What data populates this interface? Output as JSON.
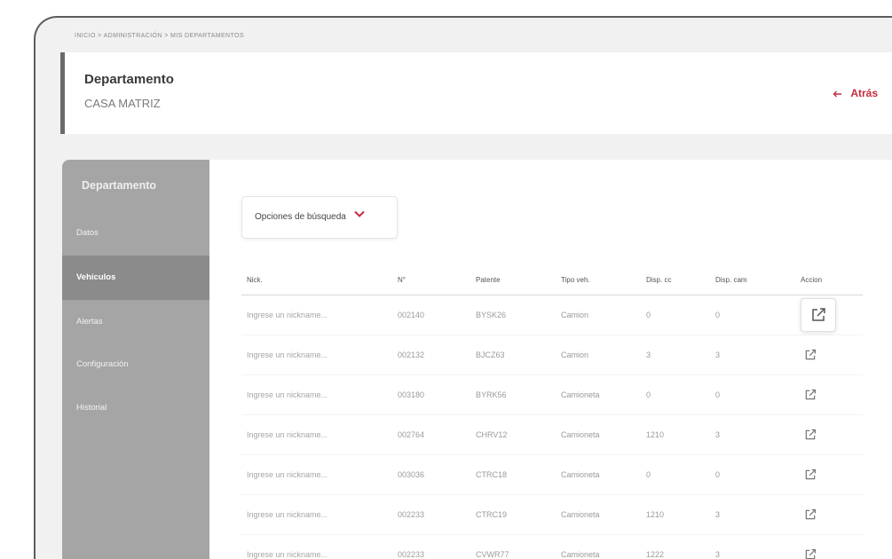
{
  "breadcrumb": "INICIO > ADMINISTRACIÓN > MIS DEPARTAMENTOS",
  "header": {
    "label": "Departamento",
    "name": "CASA MATRIZ",
    "back_label": "Atrás"
  },
  "sidebar": {
    "title": "Departamento",
    "items": [
      {
        "label": "Datos",
        "active": false
      },
      {
        "label": "Vehículos",
        "active": true
      },
      {
        "label": "Alertas",
        "active": false
      },
      {
        "label": "Configuración",
        "active": false
      },
      {
        "label": "Historial",
        "active": false
      }
    ]
  },
  "search": {
    "label": "Opciones de búsqueda"
  },
  "table": {
    "headers": [
      "Nick.",
      "N°",
      "Patente",
      "Tipo veh.",
      "Disp. cc",
      "Disp. cam",
      "Accion"
    ],
    "rows": [
      {
        "nick_placeholder": "Ingrese un nickname...",
        "num": "002140",
        "plate": "BYSK26",
        "type": "Camion",
        "disp_cc": "0",
        "disp_cam": "0"
      },
      {
        "nick_placeholder": "Ingrese un nickname...",
        "num": "002132",
        "plate": "BJCZ63",
        "type": "Camion",
        "disp_cc": "3",
        "disp_cam": "3"
      },
      {
        "nick_placeholder": "Ingrese un nickname...",
        "num": "003180",
        "plate": "BYRK56",
        "type": "Camioneta",
        "disp_cc": "0",
        "disp_cam": "0"
      },
      {
        "nick_placeholder": "Ingrese un nickname...",
        "num": "002764",
        "plate": "CHRV12",
        "type": "Camioneta",
        "disp_cc": "1210",
        "disp_cam": "3"
      },
      {
        "nick_placeholder": "Ingrese un nickname...",
        "num": "003036",
        "plate": "CTRC18",
        "type": "Camioneta",
        "disp_cc": "0",
        "disp_cam": "0"
      },
      {
        "nick_placeholder": "Ingrese un nickname...",
        "num": "002233",
        "plate": "CTRC19",
        "type": "Camioneta",
        "disp_cc": "1210",
        "disp_cam": "3"
      },
      {
        "nick_placeholder": "Ingrese un nickname...",
        "num": "002233",
        "plate": "CVWR77",
        "type": "Camioneta",
        "disp_cc": "1222",
        "disp_cam": "3"
      }
    ]
  },
  "colors": {
    "accent": "#c62a3e",
    "sidebar": "#a5a5a5",
    "sidebar_active": "#8b8b8b"
  },
  "icons": {
    "edit": "edit-icon",
    "back": "arrow-left-icon",
    "chevron": "chevron-down-icon"
  }
}
